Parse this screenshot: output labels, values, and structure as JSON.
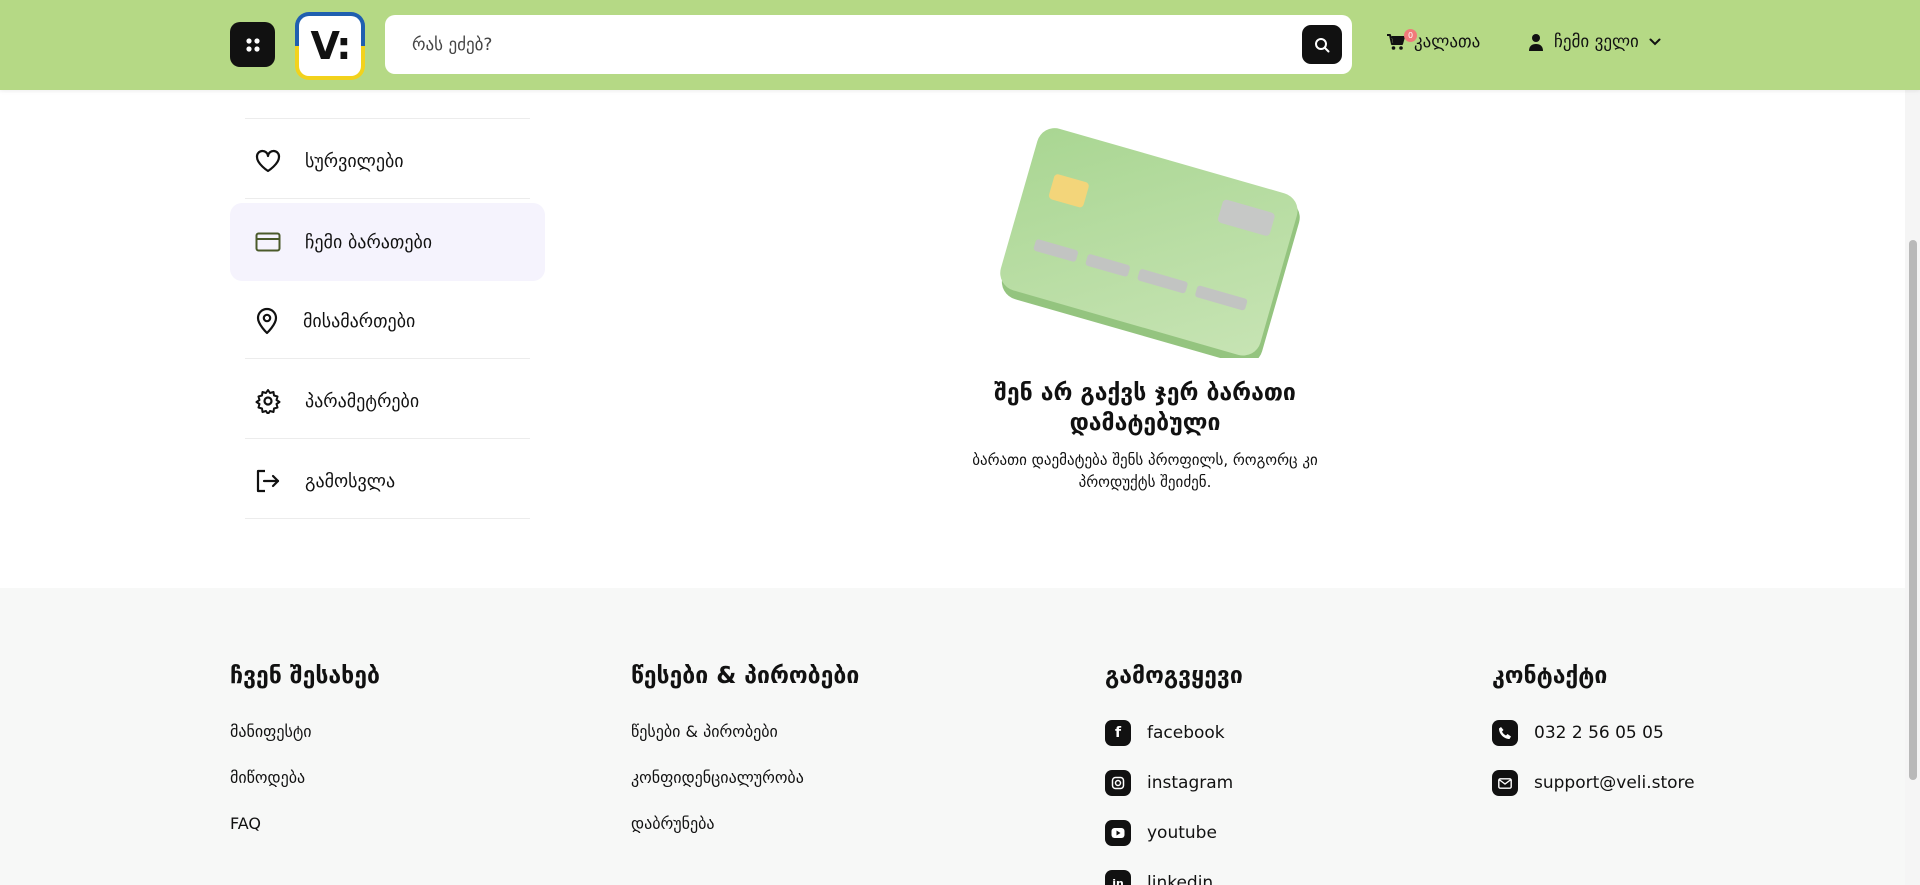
{
  "header": {
    "logo_text": "V:",
    "search_placeholder": "რას ეძებ?",
    "cart_label": "კალათა",
    "cart_count": "0",
    "user_label": "ჩემი ველი"
  },
  "sidebar": {
    "items": [
      {
        "label": "სურვილები",
        "icon": "heart-icon"
      },
      {
        "label": "ჩემი ბარათები",
        "icon": "credit-card-icon",
        "active": true
      },
      {
        "label": "მისამართები",
        "icon": "map-pin-icon"
      },
      {
        "label": "პარამეტრები",
        "icon": "gear-icon"
      },
      {
        "label": "გამოსვლა",
        "icon": "logout-icon"
      }
    ]
  },
  "empty_state": {
    "title": "შენ არ გაქვს ჯერ ბარათი დამატებული",
    "subtitle": "ბარათი დაემატება შენს პროფილს, როგორც კი პროდუქტს შეიძენ."
  },
  "footer": {
    "about": {
      "title": "ჩვენ შესახებ",
      "links": [
        "მანიფესტი",
        "მიწოდება",
        "FAQ"
      ]
    },
    "terms": {
      "title": "წესები & პირობები",
      "links": [
        "წესები & პირობები",
        "კონფიდენციალურობა",
        "დაბრუნება"
      ]
    },
    "follow": {
      "title": "გამოგვყევი",
      "links": [
        {
          "label": "facebook",
          "icon": "facebook-icon"
        },
        {
          "label": "instagram",
          "icon": "instagram-icon"
        },
        {
          "label": "youtube",
          "icon": "youtube-icon"
        },
        {
          "label": "linkedin",
          "icon": "linkedin-icon"
        }
      ]
    },
    "contact": {
      "title": "კონტაქტი",
      "phone": "032 2 56 05 05",
      "email": "support@veli.store"
    }
  },
  "colors": {
    "header_bg": "#b5d985",
    "active_item_bg": "#f5f3fd",
    "footer_bg": "#f7f8f7",
    "card_green": "#b2dc9a"
  }
}
